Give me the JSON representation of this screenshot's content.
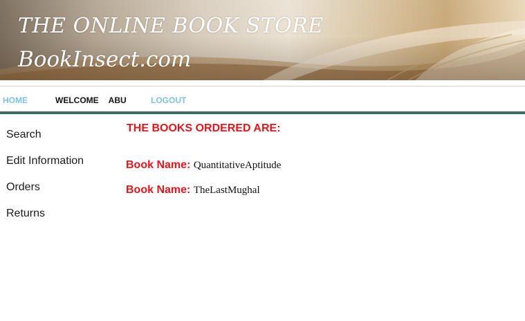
{
  "banner": {
    "title": "THE ONLINE BOOK STORE",
    "site": "BookInsect.com"
  },
  "nav": {
    "home": "HOME",
    "welcome": "WELCOME",
    "user": "ABU",
    "logout": "LOGOUT",
    "link_color": "#7ec1e0",
    "rule_color": "#3f6a64"
  },
  "sidebar": {
    "items": [
      {
        "label": "Search"
      },
      {
        "label": "Edit Information"
      },
      {
        "label": "Orders"
      },
      {
        "label": "Returns"
      }
    ]
  },
  "main": {
    "heading": "THE BOOKS ORDERED ARE:",
    "accent_color": "#e4151b",
    "books": [
      {
        "label": "Book Name:",
        "name": "QuantitativeAptitude"
      },
      {
        "label": "Book Name:",
        "name": "TheLastMughal"
      }
    ]
  }
}
